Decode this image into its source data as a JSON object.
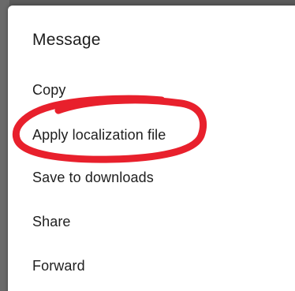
{
  "dialog": {
    "title": "Message",
    "items": [
      {
        "label": "Copy"
      },
      {
        "label": "Apply localization file"
      },
      {
        "label": "Save to downloads"
      },
      {
        "label": "Share"
      },
      {
        "label": "Forward"
      }
    ]
  },
  "annotation": {
    "shape": "hand-drawn-ellipse",
    "color": "#e8202c",
    "highlights": "Apply localization file"
  }
}
